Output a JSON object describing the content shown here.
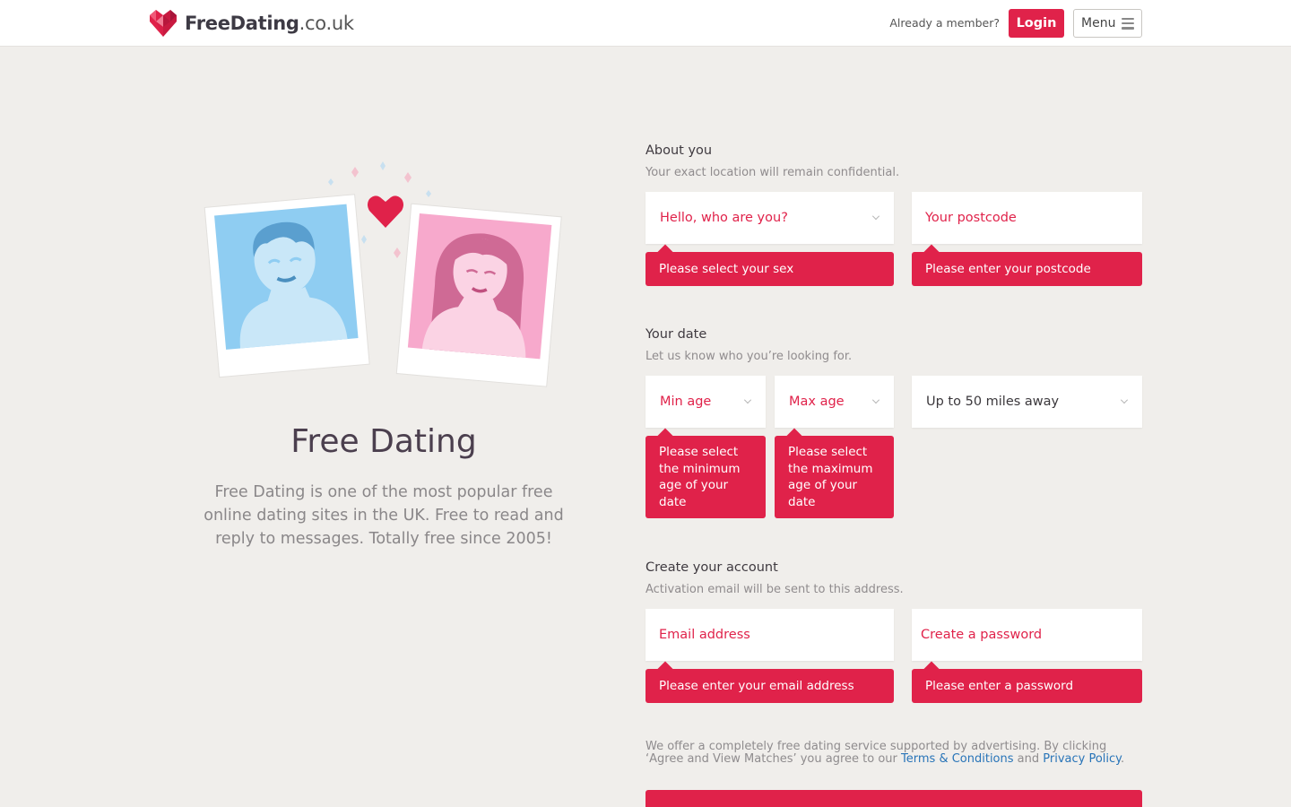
{
  "header": {
    "brand_bold": "FreeDating",
    "brand_tld": ".co.uk",
    "already_member": "Already a member?",
    "login_label": "Login",
    "menu_label": "Menu"
  },
  "hero": {
    "title": "Free Dating",
    "description": "Free Dating is one of the most popular free online dating sites in the UK. Free to read and reply to messages. Totally free since 2005!"
  },
  "about": {
    "title": "About you",
    "subtitle": "Your exact location will remain confidential.",
    "sex_placeholder": "Hello, who are you?",
    "sex_error": "Please select your sex",
    "postcode_placeholder": "Your postcode",
    "postcode_error": "Please enter your postcode"
  },
  "date": {
    "title": "Your date",
    "subtitle": "Let us know who you’re looking for.",
    "min_age_placeholder": "Min age",
    "min_age_error": "Please select the minimum age of your date",
    "max_age_placeholder": "Max age",
    "max_age_error": "Please select the maximum age of your date",
    "distance_value": "Up to 50 miles away"
  },
  "account": {
    "title": "Create your account",
    "subtitle": "Activation email will be sent to this address.",
    "email_placeholder": "Email address",
    "email_error": "Please enter your email address",
    "password_placeholder": "Create a password",
    "password_error": "Please enter a password"
  },
  "legal": {
    "text_before": "We offer a completely free dating service supported by advertising. By clicking ‘Agree and View Matches’ you agree to our ",
    "terms_link": "Terms & Conditions",
    "text_and": " and ",
    "privacy_link": "Privacy Policy",
    "text_end": "."
  },
  "colors": {
    "accent": "#e0224a",
    "background": "#f0eeeb",
    "link": "#2874b8"
  }
}
